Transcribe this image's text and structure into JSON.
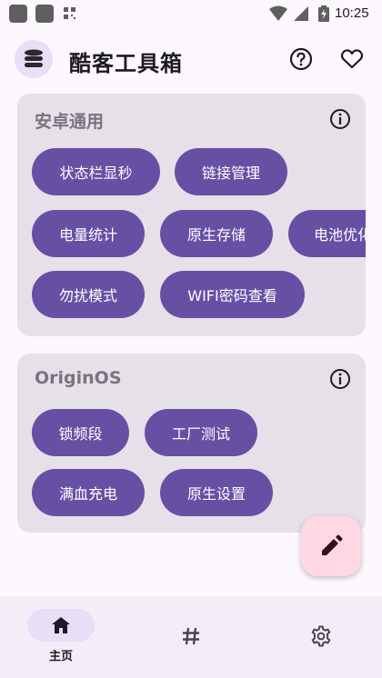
{
  "status_bar": {
    "time": "10:25"
  },
  "header": {
    "title": "酷客工具箱"
  },
  "sections": [
    {
      "title": "安卓通用",
      "chips": [
        "状态栏显秒",
        "链接管理",
        "电量统计",
        "原生存储",
        "电池优化",
        "勿扰模式",
        "WIFI密码查看"
      ]
    },
    {
      "title": "OriginOS",
      "chips": [
        "锁频段",
        "工厂测试",
        "满血充电",
        "原生设置"
      ]
    }
  ],
  "bottom_nav": {
    "home_label": "主页"
  },
  "colors": {
    "chip": "#6750a4",
    "card": "#e6e0e9",
    "fab": "#ffd8e4",
    "nav": "#f3edf7"
  }
}
